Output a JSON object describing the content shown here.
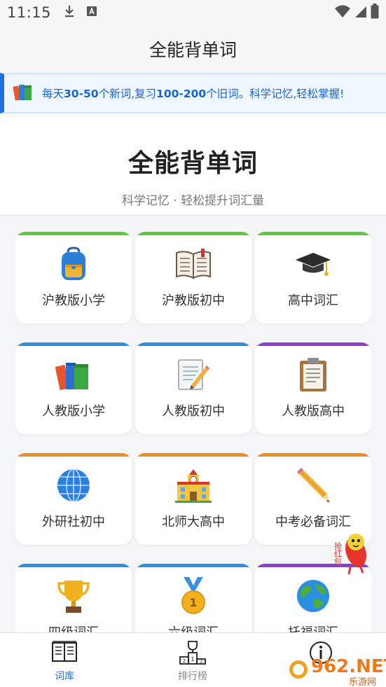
{
  "status_bar": {
    "time": "11:15"
  },
  "header": {
    "title": "全能背单词"
  },
  "notice": {
    "segments": [
      {
        "text": "每天",
        "bold": false
      },
      {
        "text": "30-50",
        "bold": true
      },
      {
        "text": "个新词,复习",
        "bold": false
      },
      {
        "text": "100-200",
        "bold": true
      },
      {
        "text": "个旧词。科学记忆,轻松掌握!",
        "bold": false
      }
    ]
  },
  "hero": {
    "title": "全能背单词",
    "subtitle": "科学记忆 · 轻松提升词汇量"
  },
  "categories": [
    {
      "label": "沪教版小学",
      "icon": "backpack-icon",
      "accent": "#5cc93d"
    },
    {
      "label": "沪教版初中",
      "icon": "book-icon",
      "accent": "#5cc93d"
    },
    {
      "label": "高中词汇",
      "icon": "graduation-cap-icon",
      "accent": "#5cc93d"
    },
    {
      "label": "人教版小学",
      "icon": "books-icon",
      "accent": "#2f8fe6"
    },
    {
      "label": "人教版初中",
      "icon": "memo-icon",
      "accent": "#2f8fe6"
    },
    {
      "label": "人教版高中",
      "icon": "clipboard-icon",
      "accent": "#8a3fd1"
    },
    {
      "label": "外研社初中",
      "icon": "globe-icon",
      "accent": "#f28c28"
    },
    {
      "label": "北师大高中",
      "icon": "school-icon",
      "accent": "#f28c28"
    },
    {
      "label": "中考必备词汇",
      "icon": "pencil-icon",
      "accent": "#f28c28"
    },
    {
      "label": "四级词汇",
      "icon": "trophy-icon",
      "accent": "#2f8fe6"
    },
    {
      "label": "六级词汇",
      "icon": "medal-icon",
      "accent": "#2f8fe6"
    },
    {
      "label": "托福词汇",
      "icon": "earth-icon",
      "accent": "#8a3fd1"
    }
  ],
  "floating_badge": {
    "text": "抢红包"
  },
  "bottom_nav": {
    "items": [
      {
        "label": "词库",
        "icon": "dictionary-icon",
        "active": true
      },
      {
        "label": "排行榜",
        "icon": "podium-icon",
        "active": false
      },
      {
        "label": "",
        "icon": "info-icon",
        "active": false
      }
    ]
  },
  "watermark": {
    "text": "962.NET",
    "subtext": "乐游网"
  },
  "colors": {
    "accent": "#1e6fe0",
    "active_nav": "#2a6fe0"
  }
}
